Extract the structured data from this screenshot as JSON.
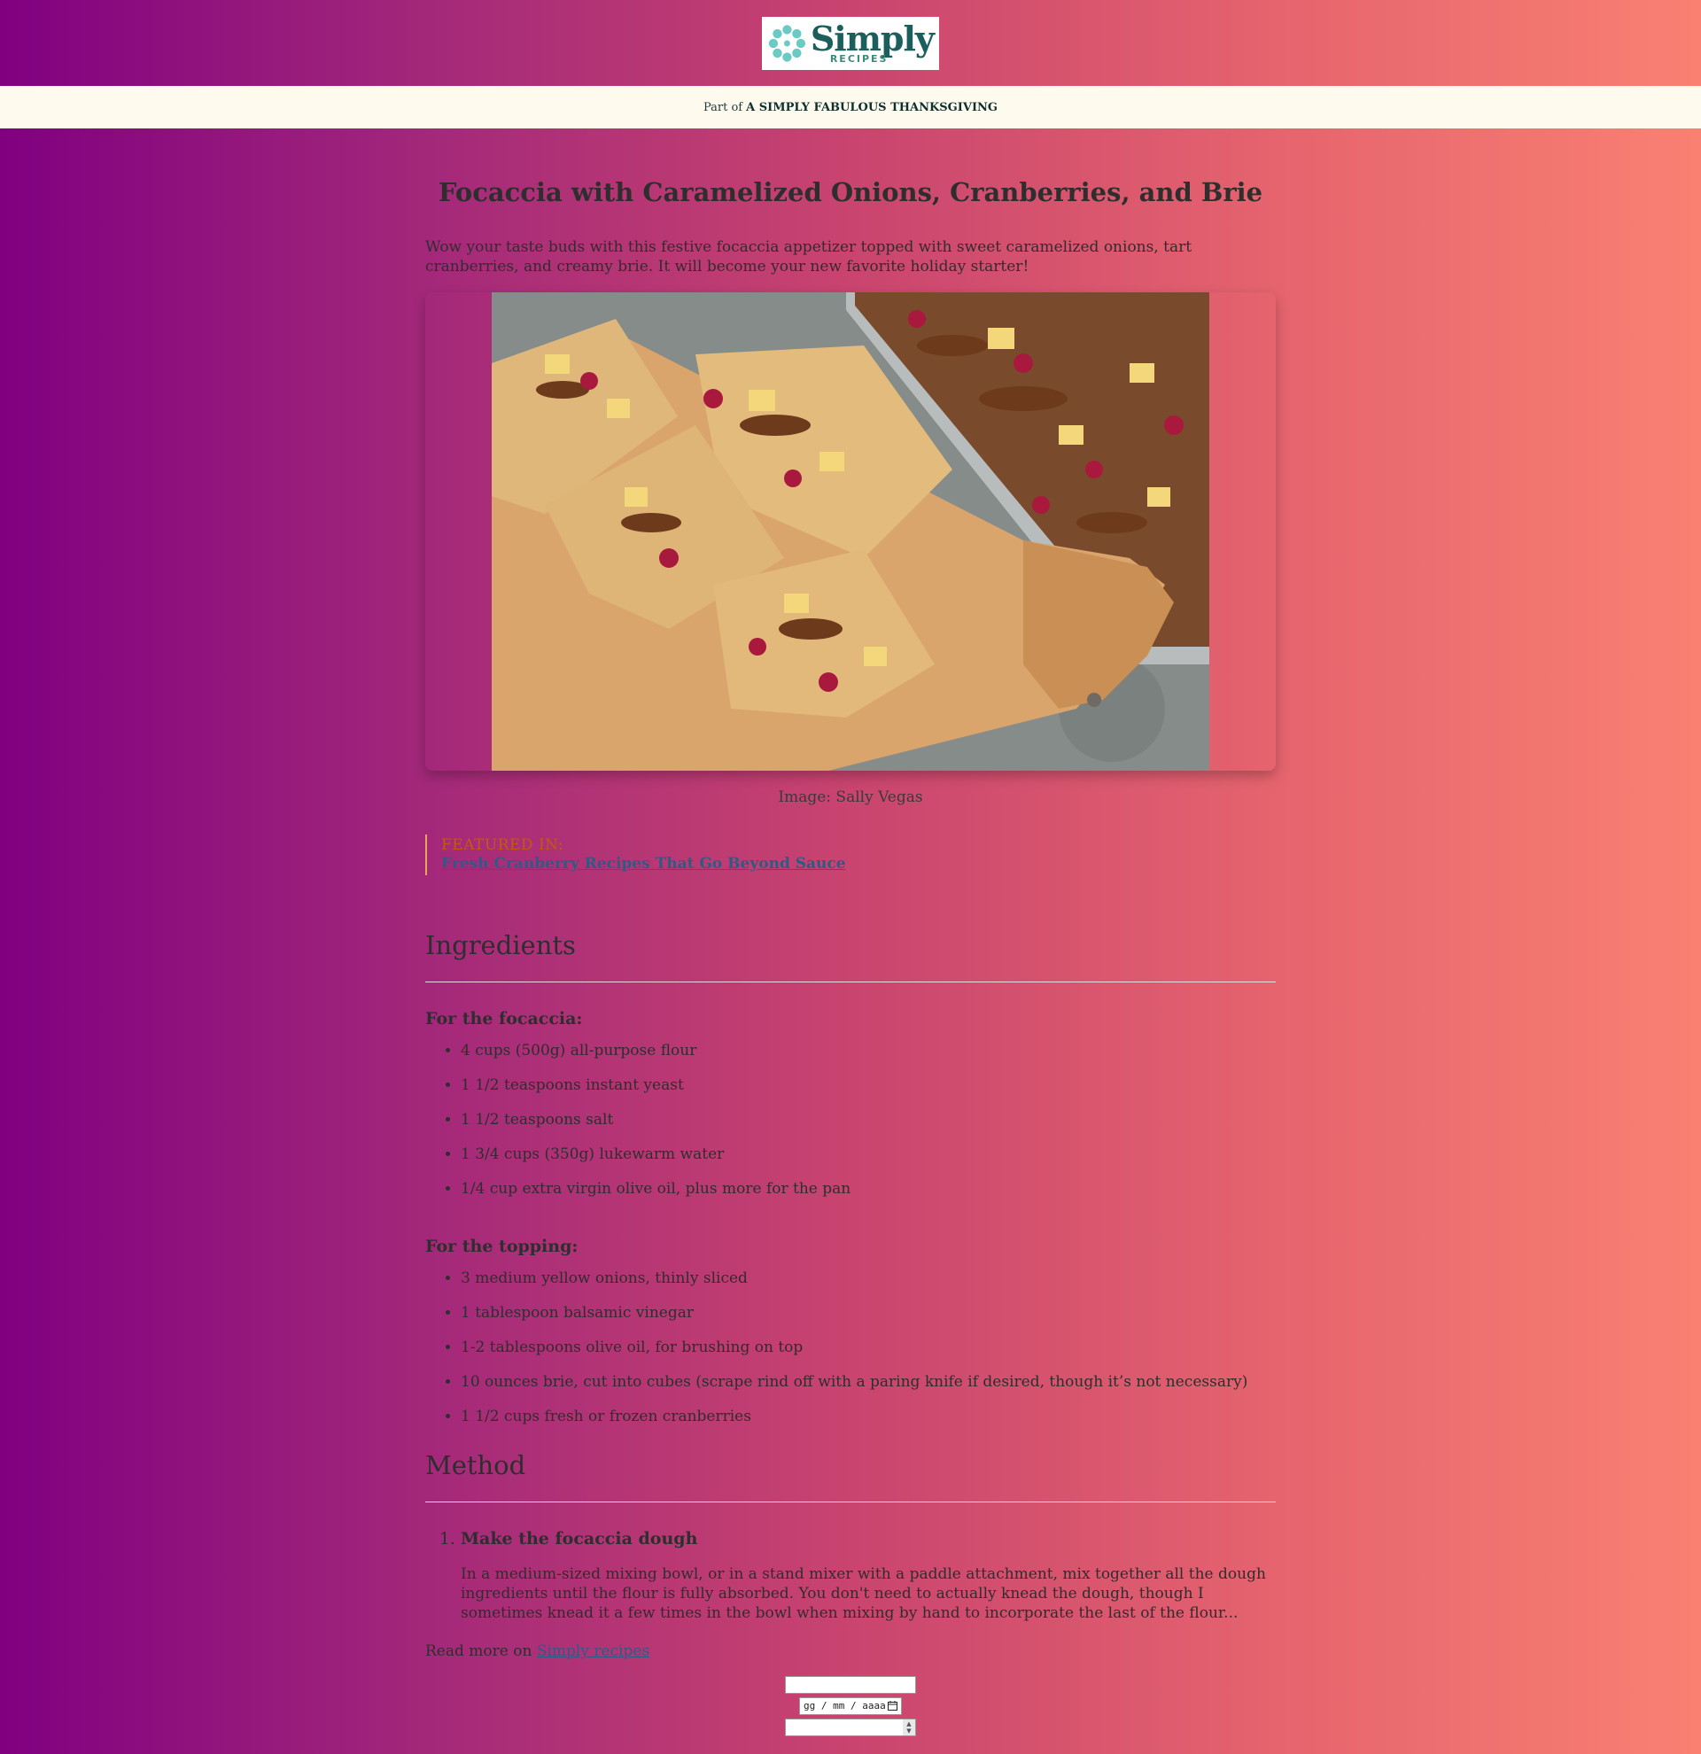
{
  "header": {
    "logo_word": "Simply",
    "logo_sub": "RECIPES"
  },
  "series": {
    "prefix": "Part of",
    "name": "A SIMPLY FABULOUS THANKSGIVING"
  },
  "article": {
    "title": "Focaccia with Caramelized Onions, Cranberries, and Brie",
    "intro": "Wow your taste buds with this festive focaccia appetizer topped with sweet caramelized onions, tart cranberries, and creamy brie. It will become your new favorite holiday starter!",
    "image_caption": "Image: Sally Vegas"
  },
  "featured": {
    "label": "FEATURED IN:",
    "link": "Fresh Cranberry Recipes That Go Beyond Sauce"
  },
  "ingredients": {
    "heading": "Ingredients",
    "groups": [
      {
        "title": "For the focaccia:",
        "items": [
          "4 cups (500g) all-purpose flour",
          "1 1/2 teaspoons instant yeast",
          "1 1/2 teaspoons salt",
          "1 3/4 cups (350g) lukewarm water",
          "1/4 cup extra virgin olive oil, plus more for the pan"
        ]
      },
      {
        "title": "For the topping:",
        "items": [
          "3 medium yellow onions, thinly sliced",
          "1 tablespoon balsamic vinegar",
          "1-2 tablespoons olive oil, for brushing on top",
          "10 ounces brie, cut into cubes (scrape rind off with a paring knife if desired, though it’s not necessary)",
          "1 1/2 cups fresh or frozen cranberries"
        ]
      }
    ]
  },
  "method": {
    "heading": "Method",
    "steps": [
      {
        "title": "Make the focaccia dough",
        "body": "In a medium-sized mixing bowl, or in a stand mixer with a paddle attachment, mix together all the dough ingredients until the flour is fully absorbed. You don't need to actually knead the dough, though I sometimes knead it a few times in the bowl when mixing by hand to incorporate the last of the flour..."
      }
    ]
  },
  "readmore": {
    "prefix": "Read more on",
    "link": "Simply recipes"
  },
  "form": {
    "date_placeholder": "gg / mm / aaaa"
  }
}
